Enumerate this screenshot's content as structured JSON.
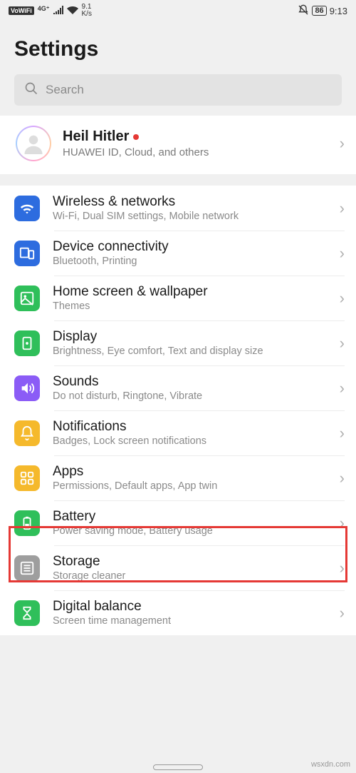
{
  "statusbar": {
    "vowifi_label": "VoWiFi",
    "net_label": "4G⁺",
    "speed_top": "9.1",
    "speed_bottom": "K/s",
    "battery": "86",
    "time": "9:13"
  },
  "header": {
    "title": "Settings"
  },
  "search": {
    "placeholder": "Search"
  },
  "profile": {
    "name": "Heil Hitler",
    "subtitle": "HUAWEI ID, Cloud, and others"
  },
  "items": [
    {
      "id": "wireless",
      "icon": "wifi-icon",
      "bg": "bg-blue",
      "title": "Wireless & networks",
      "sub": "Wi-Fi, Dual SIM settings, Mobile network"
    },
    {
      "id": "devconn",
      "icon": "devices-icon",
      "bg": "bg-blue2",
      "title": "Device connectivity",
      "sub": "Bluetooth, Printing"
    },
    {
      "id": "homescreen",
      "icon": "picture-icon",
      "bg": "bg-green",
      "title": "Home screen & wallpaper",
      "sub": "Themes"
    },
    {
      "id": "display",
      "icon": "display-icon",
      "bg": "bg-green2",
      "title": "Display",
      "sub": "Brightness, Eye comfort, Text and display size"
    },
    {
      "id": "sounds",
      "icon": "sound-icon",
      "bg": "bg-purple",
      "title": "Sounds",
      "sub": "Do not disturb, Ringtone, Vibrate"
    },
    {
      "id": "notif",
      "icon": "bell-icon",
      "bg": "bg-amber",
      "title": "Notifications",
      "sub": "Badges, Lock screen notifications"
    },
    {
      "id": "apps",
      "icon": "apps-icon",
      "bg": "bg-amber2",
      "title": "Apps",
      "sub": "Permissions, Default apps, App twin"
    },
    {
      "id": "battery",
      "icon": "battery-icon",
      "bg": "bg-green3",
      "title": "Battery",
      "sub": "Power saving mode, Battery usage"
    },
    {
      "id": "storage",
      "icon": "storage-icon",
      "bg": "bg-gray",
      "title": "Storage",
      "sub": "Storage cleaner"
    },
    {
      "id": "digital",
      "icon": "hourglass-icon",
      "bg": "bg-green4",
      "title": "Digital balance",
      "sub": "Screen time management"
    }
  ],
  "watermark": "wsxdn.com"
}
